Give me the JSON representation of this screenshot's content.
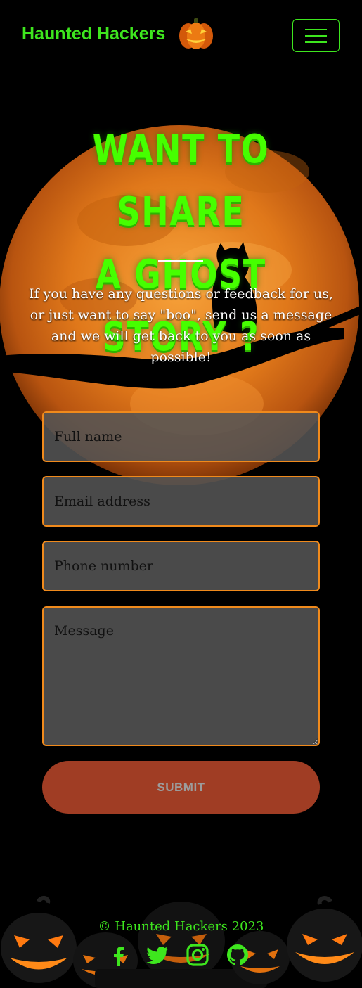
{
  "navbar": {
    "brand": "Haunted Hackers"
  },
  "hero": {
    "title_line1": "Want to share",
    "title_line2": "a ghost story ?",
    "intro": "If you have any questions or feedback for us, or just want to say \"boo\", send us a message and we will get back to you as soon as possible!"
  },
  "form": {
    "full_name_placeholder": "Full name",
    "email_placeholder": "Email address",
    "phone_placeholder": "Phone number",
    "message_placeholder": "Message",
    "submit_label": "SUBMIT"
  },
  "footer": {
    "copyright": "© Haunted Hackers 2023",
    "social_icons": [
      "facebook-icon",
      "twitter-icon",
      "instagram-icon",
      "github-icon"
    ]
  },
  "colors": {
    "accent_green": "#3ee61e",
    "field_border": "#f08a1c",
    "submit_bg": "#a03d24"
  }
}
